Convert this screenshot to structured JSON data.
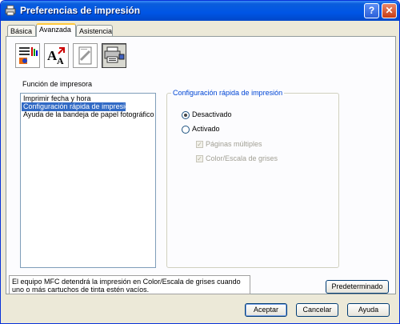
{
  "window": {
    "title": "Preferencias de impresión"
  },
  "tabs": [
    {
      "label": "Básica"
    },
    {
      "label": "Avanzada"
    },
    {
      "label": "Asistencia"
    }
  ],
  "icons": [
    "color-icon",
    "scaling-icon",
    "watermark-icon",
    "device-options-icon"
  ],
  "printer_function": {
    "label": "Función de impresora",
    "items": [
      {
        "label": "Imprimir fecha y hora"
      },
      {
        "label": "Configuración rápida de impresión"
      },
      {
        "label": "Ayuda de la bandeja de papel fotográfico"
      }
    ],
    "selected_index": 1
  },
  "quick_print": {
    "title": "Configuración rápida de impresión",
    "off_label": "Desactivado",
    "on_label": "Activado",
    "multipage_label": "Páginas múltiples",
    "color_label": "Color/Escala de grises"
  },
  "status_text": "El equipo MFC detendrá la impresión en Color/Escala de grises cuando uno o más cartuchos de tinta estén vacíos.",
  "buttons": {
    "default": "Predeterminado",
    "accept": "Aceptar",
    "cancel": "Cancelar",
    "help": "Ayuda"
  }
}
